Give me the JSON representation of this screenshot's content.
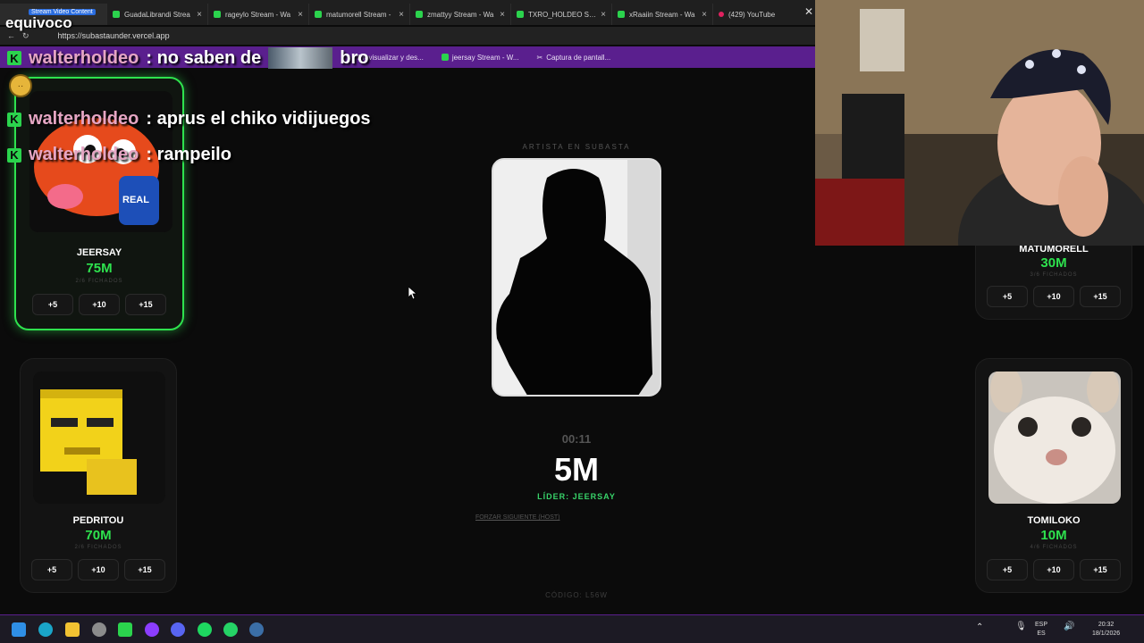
{
  "browser": {
    "tabs": [
      {
        "label": "",
        "icon": "stream-video-icon"
      },
      {
        "label": "GuadaLibrandi Strea",
        "icon": "kick-icon"
      },
      {
        "label": "rageylo Stream - Wa",
        "icon": "kick-icon"
      },
      {
        "label": "matumorell Stream -",
        "icon": "kick-icon"
      },
      {
        "label": "zmattyy Stream - Wa",
        "icon": "kick-icon"
      },
      {
        "label": "TXRO_HOLDEO Strea",
        "icon": "kick-icon"
      },
      {
        "label": "xRaaiin Stream - Wa",
        "icon": "kick-icon"
      },
      {
        "label": "(429) YouTube",
        "icon": "youtube-icon"
      }
    ],
    "stream_video_badge": "Stream Video Content",
    "url": "https://subastaunder.vercel.app",
    "bookmarks": [
      "Previsualizar y des...",
      "jeersay Stream - W...",
      "Captura de pantall..."
    ]
  },
  "chat": {
    "overlay_word": "equivoco",
    "messages": [
      {
        "user": "walterholdeo",
        "text": ": no saben de",
        "suffix": "bro"
      },
      {
        "user": "walterholdeo",
        "text": ": aprus el chiko vidijuegos"
      },
      {
        "user": "walterholdeo",
        "text": ": rampeilo"
      }
    ]
  },
  "auction": {
    "artist_label": "ARTISTA EN SUBASTA",
    "timer": "00:11",
    "price": "5M",
    "leader": "LÍDER: JEERSAY",
    "force_next": "FORZAR SIGUIENTE (HOST)",
    "code": "CÓDIGO: L56W"
  },
  "players": [
    {
      "name": "JEERSAY",
      "money": "75M",
      "signed": "2/6 FICHADOS",
      "bids": [
        "+5",
        "+10",
        "+15"
      ]
    },
    {
      "name": "PEDRITOU",
      "money": "70M",
      "signed": "2/6 FICHADOS",
      "bids": [
        "+5",
        "+10",
        "+15"
      ]
    },
    {
      "name": "MATUMORELL",
      "money": "30M",
      "signed": "3/6 FICHADOS",
      "bids": [
        "+5",
        "+10",
        "+15"
      ]
    },
    {
      "name": "TOMILOKO",
      "money": "10M",
      "signed": "4/6 FICHADOS",
      "bids": [
        "+5",
        "+10",
        "+15"
      ]
    }
  ],
  "taskbar": {
    "lang": "ESP",
    "region": "ES",
    "time": "20:32",
    "date": "18/1/2026"
  },
  "colors": {
    "accent_green": "#2ee24e",
    "chrome_purple": "#5a1f8e",
    "username_pink": "#e6a6c4"
  }
}
